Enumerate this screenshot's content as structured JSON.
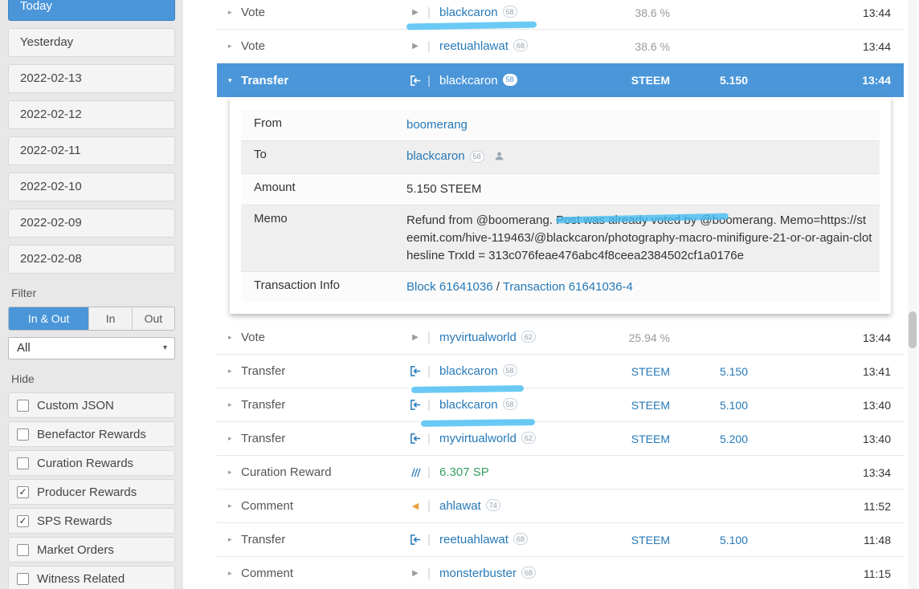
{
  "colors": {
    "accent": "#4a96d9",
    "link": "#2679b8",
    "marker": "#45bdf2",
    "reward_green": "#33a05f"
  },
  "sidebar": {
    "dates": [
      "Today",
      "Yesterday",
      "2022-02-13",
      "2022-02-12",
      "2022-02-11",
      "2022-02-10",
      "2022-02-09",
      "2022-02-08"
    ],
    "active_date": "Today",
    "filter_label": "Filter",
    "filter_options": [
      "In & Out",
      "In",
      "Out"
    ],
    "active_filter": "In & Out",
    "dropdown_value": "All",
    "hide_label": "Hide",
    "hide_options": [
      {
        "label": "Custom JSON",
        "checked": false
      },
      {
        "label": "Benefactor Rewards",
        "checked": false
      },
      {
        "label": "Curation Rewards",
        "checked": false
      },
      {
        "label": "Producer Rewards",
        "checked": true
      },
      {
        "label": "SPS Rewards",
        "checked": true
      },
      {
        "label": "Market Orders",
        "checked": false
      },
      {
        "label": "Witness Related",
        "checked": false
      }
    ]
  },
  "operations": [
    {
      "type": "Vote",
      "icon": "play-icon",
      "user": "blackcaron",
      "rep": "58",
      "value": "38.6 %",
      "time": "13:44",
      "highlighted": true
    },
    {
      "type": "Vote",
      "icon": "play-icon",
      "user": "reetuahlawat",
      "rep": "68",
      "value": "38.6 %",
      "time": "13:44"
    },
    {
      "type": "Transfer",
      "icon": "transfer-in-icon",
      "user": "blackcaron",
      "rep": "58",
      "value": "STEEM",
      "amount": "5.150",
      "time": "13:44",
      "expanded": true
    },
    {
      "type": "Vote",
      "icon": "play-icon",
      "user": "myvirtualworld",
      "rep": "62",
      "value": "25.94 %",
      "time": "13:44"
    },
    {
      "type": "Transfer",
      "icon": "transfer-in-icon",
      "user": "blackcaron",
      "rep": "58",
      "value": "STEEM",
      "amount": "5.150",
      "time": "13:41",
      "highlighted": true
    },
    {
      "type": "Transfer",
      "icon": "transfer-in-icon",
      "user": "blackcaron",
      "rep": "58",
      "value": "STEEM",
      "amount": "5.100",
      "time": "13:40",
      "highlighted": true
    },
    {
      "type": "Transfer",
      "icon": "transfer-in-icon",
      "user": "myvirtualworld",
      "rep": "62",
      "value": "STEEM",
      "amount": "5.200",
      "time": "13:40"
    },
    {
      "type": "Curation Reward",
      "icon": "curation-icon",
      "reward": "6.307 SP",
      "time": "13:34"
    },
    {
      "type": "Comment",
      "icon": "comment-icon",
      "user": "ahlawat",
      "rep": "74",
      "time": "11:52"
    },
    {
      "type": "Transfer",
      "icon": "transfer-in-icon",
      "user": "reetuahlawat",
      "rep": "68",
      "value": "STEEM",
      "amount": "5.100",
      "time": "11:48"
    },
    {
      "type": "Comment",
      "icon": "play-icon",
      "user": "monsterbuster",
      "rep": "68",
      "time": "11:15"
    }
  ],
  "detail": {
    "from_label": "From",
    "from_value": "boomerang",
    "to_label": "To",
    "to_value": "blackcaron",
    "to_rep": "58",
    "amount_label": "Amount",
    "amount_value": "5.150 STEEM",
    "memo_label": "Memo",
    "memo_value": "Refund from @boomerang. Post was already voted by @boomerang. Memo=https://steemit.com/hive-119463/@blackcaron/photography-macro-minifigure-21-or-or-again-clothesline TrxId = 313c076feae476abc4f8ceea2384502cf1a0176e",
    "tx_label": "Transaction Info",
    "tx_block": "Block 61641036",
    "tx_sep": " / ",
    "tx_transaction": "Transaction 61641036-4"
  }
}
